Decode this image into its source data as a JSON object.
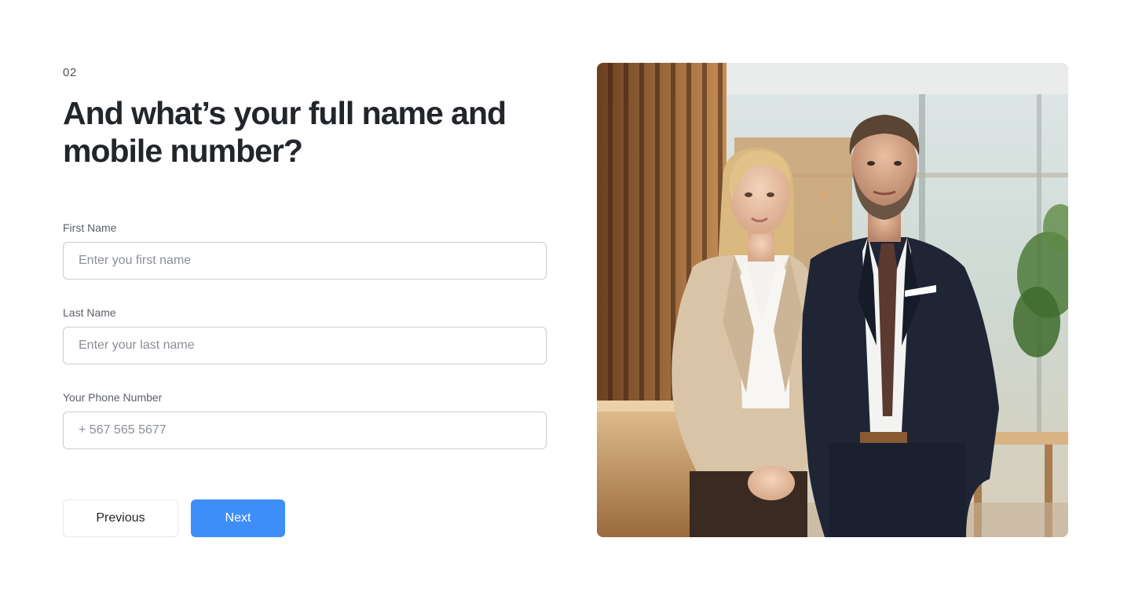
{
  "form": {
    "step": "02",
    "heading": "And what’s your full name and mobile number?",
    "fields": [
      {
        "label": "First Name",
        "placeholder": "Enter you first name",
        "value": ""
      },
      {
        "label": "Last Name",
        "placeholder": "Enter your last name",
        "value": ""
      },
      {
        "label": "Your Phone Number",
        "placeholder": "+ 567 565 5677",
        "value": ""
      }
    ],
    "buttons": {
      "previous": "Previous",
      "next": "Next"
    }
  },
  "colors": {
    "accent": "#3d8ef7",
    "heading": "#22262b",
    "border": "#c9ccd1"
  },
  "image": {
    "subject": "two business professionals standing in an office"
  }
}
